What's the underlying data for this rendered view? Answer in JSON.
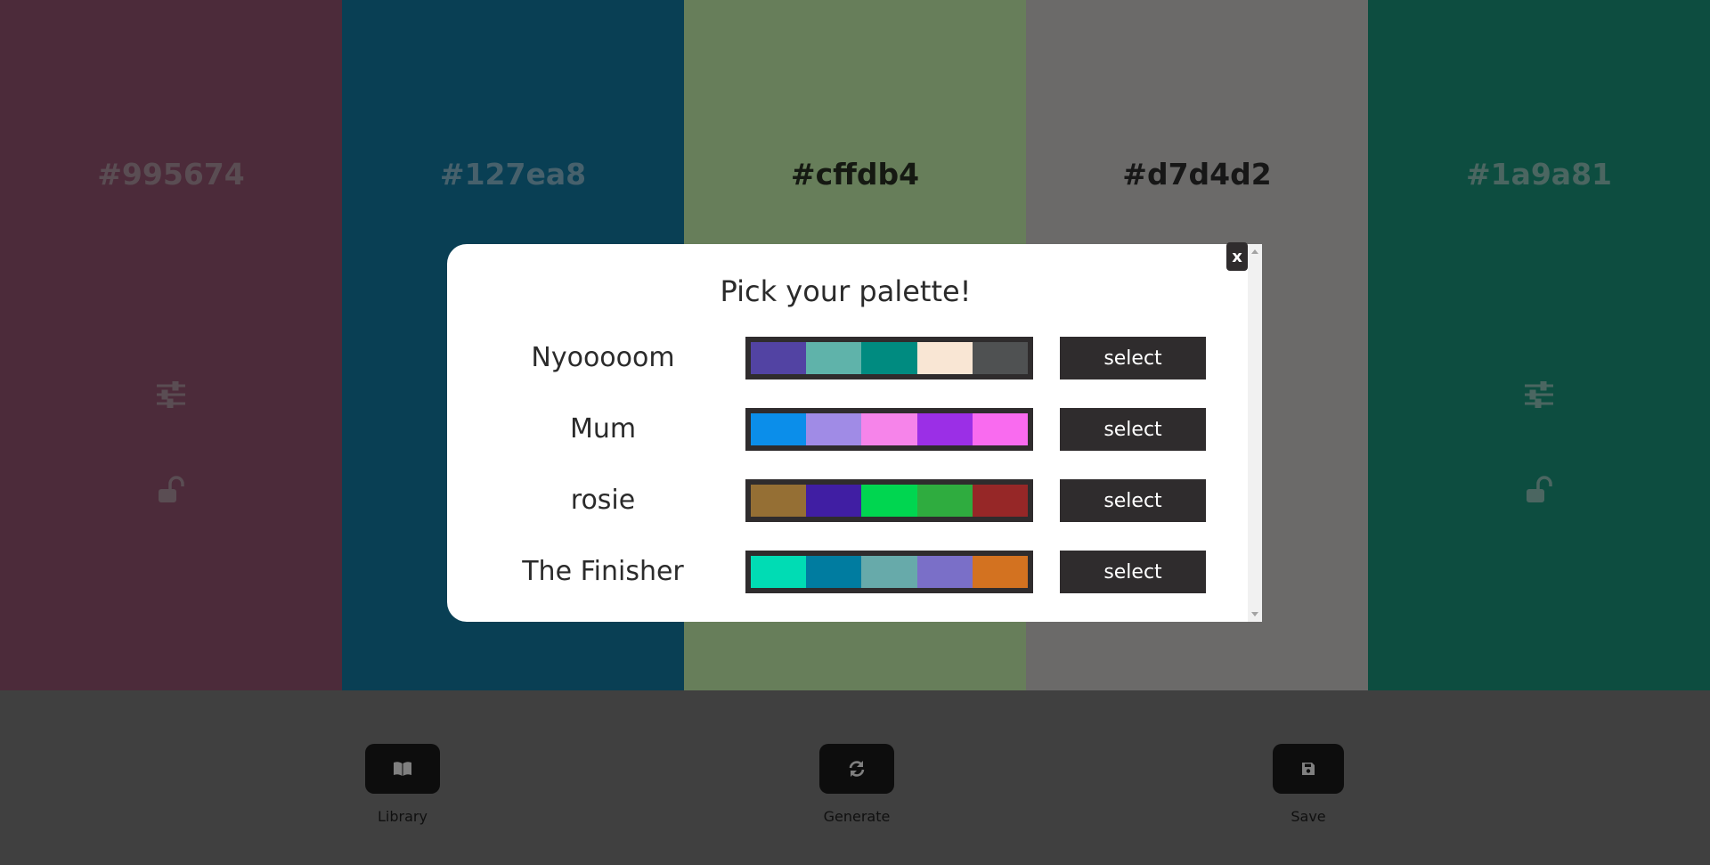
{
  "colors": [
    {
      "hex": "#995674",
      "bg": "#995674",
      "text_color": "#b49aa6",
      "show_controls": true
    },
    {
      "hex": "#127ea8",
      "bg": "#127ea8",
      "text_color": "#8fc3d8",
      "show_controls": false
    },
    {
      "hex": "#cffdb4",
      "bg": "#cffdb4",
      "text_color": "#2a3325",
      "show_controls": false
    },
    {
      "hex": "#d7d4d2",
      "bg": "#d7d4d2",
      "text_color": "#2e2e2e",
      "show_controls": false
    },
    {
      "hex": "#1a9a81",
      "bg": "#1a9a81",
      "text_color": "#96ccc2",
      "show_controls": true
    }
  ],
  "icons": {
    "adjust": "sliders-icon",
    "lock": "unlock-icon"
  },
  "controls": [
    {
      "label": "Library",
      "icon": "book-icon"
    },
    {
      "label": "Generate",
      "icon": "refresh-icon"
    },
    {
      "label": "Save",
      "icon": "save-icon"
    }
  ],
  "modal": {
    "title": "Pick your palette!",
    "close_label": "x",
    "palettes": [
      {
        "name": "Nyooooom",
        "colors": [
          "#5243a3",
          "#5fb3aa",
          "#008b80",
          "#f9e6d4",
          "#4f5152"
        ],
        "select_label": "select"
      },
      {
        "name": "Mum",
        "colors": [
          "#0b8eea",
          "#a08be6",
          "#f684ea",
          "#9b2fe6",
          "#f96bef"
        ],
        "select_label": "select"
      },
      {
        "name": "rosie",
        "colors": [
          "#956f34",
          "#401ea3",
          "#00d650",
          "#2fac3f",
          "#962727"
        ],
        "select_label": "select"
      },
      {
        "name": "The Finisher",
        "colors": [
          "#00dcb4",
          "#007ca0",
          "#67aaaa",
          "#7a6fc8",
          "#d37220"
        ],
        "select_label": "select"
      }
    ]
  }
}
